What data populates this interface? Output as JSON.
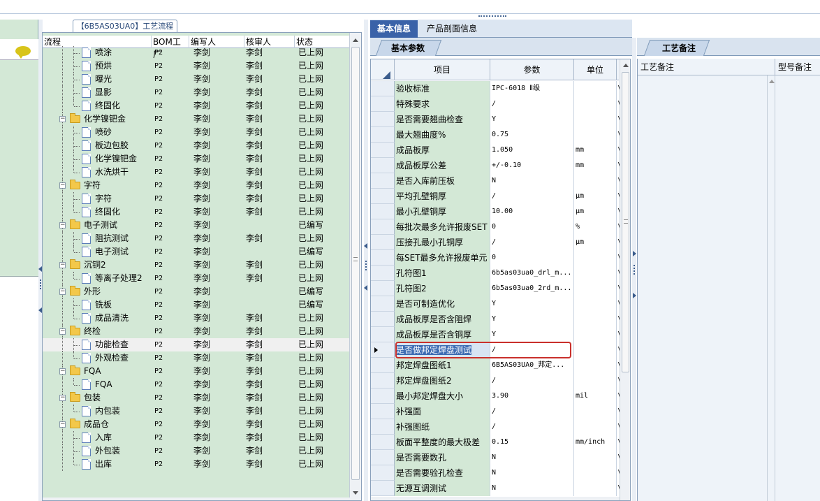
{
  "tree": {
    "title": "【6B5AS03UA0】工艺流程",
    "columns": {
      "flow": "流程",
      "bom": "BOM工厂",
      "writer": "编写人",
      "reviewer": "核审人",
      "status": "状态"
    },
    "rows": [
      {
        "type": "leaf",
        "label": "喷涂",
        "bom": "P2",
        "writer": "李剑",
        "reviewer": "李剑",
        "status": "已上网"
      },
      {
        "type": "leaf",
        "label": "预烘",
        "bom": "P2",
        "writer": "李剑",
        "reviewer": "李剑",
        "status": "已上网"
      },
      {
        "type": "leaf",
        "label": "曝光",
        "bom": "P2",
        "writer": "李剑",
        "reviewer": "李剑",
        "status": "已上网"
      },
      {
        "type": "leaf",
        "label": "显影",
        "bom": "P2",
        "writer": "李剑",
        "reviewer": "李剑",
        "status": "已上网"
      },
      {
        "type": "leaf",
        "label": "终固化",
        "bom": "P2",
        "writer": "李剑",
        "reviewer": "李剑",
        "status": "已上网"
      },
      {
        "type": "folder",
        "label": "化学镍钯金",
        "bom": "P2",
        "writer": "李剑",
        "reviewer": "李剑",
        "status": "已上网"
      },
      {
        "type": "leaf",
        "label": "喷砂",
        "bom": "P2",
        "writer": "李剑",
        "reviewer": "李剑",
        "status": "已上网"
      },
      {
        "type": "leaf",
        "label": "板边包胶",
        "bom": "P2",
        "writer": "李剑",
        "reviewer": "李剑",
        "status": "已上网"
      },
      {
        "type": "leaf",
        "label": "化学镍钯金",
        "bom": "P2",
        "writer": "李剑",
        "reviewer": "李剑",
        "status": "已上网"
      },
      {
        "type": "leaf",
        "label": "水洗烘干",
        "bom": "P2",
        "writer": "李剑",
        "reviewer": "李剑",
        "status": "已上网"
      },
      {
        "type": "folder",
        "label": "字符",
        "bom": "P2",
        "writer": "李剑",
        "reviewer": "李剑",
        "status": "已上网"
      },
      {
        "type": "leaf",
        "label": "字符",
        "bom": "P2",
        "writer": "李剑",
        "reviewer": "李剑",
        "status": "已上网"
      },
      {
        "type": "leaf",
        "label": "终固化",
        "bom": "P2",
        "writer": "李剑",
        "reviewer": "李剑",
        "status": "已上网"
      },
      {
        "type": "folder",
        "label": "电子测试",
        "bom": "P2",
        "writer": "李剑",
        "reviewer": "",
        "status": "已编写"
      },
      {
        "type": "leaf",
        "label": "阻抗测试",
        "bom": "P2",
        "writer": "李剑",
        "reviewer": "李剑",
        "status": "已上网"
      },
      {
        "type": "leaf",
        "label": "电子测试",
        "bom": "P2",
        "writer": "李剑",
        "reviewer": "",
        "status": "已编写"
      },
      {
        "type": "folder",
        "label": "沉铜2",
        "bom": "P2",
        "writer": "李剑",
        "reviewer": "李剑",
        "status": "已上网"
      },
      {
        "type": "leaf",
        "label": "等离子处理2",
        "bom": "P2",
        "writer": "李剑",
        "reviewer": "李剑",
        "status": "已上网"
      },
      {
        "type": "folder",
        "label": "外形",
        "bom": "P2",
        "writer": "李剑",
        "reviewer": "",
        "status": "已编写"
      },
      {
        "type": "leaf",
        "label": "铣板",
        "bom": "P2",
        "writer": "李剑",
        "reviewer": "",
        "status": "已编写"
      },
      {
        "type": "leaf",
        "label": "成品清洗",
        "bom": "P2",
        "writer": "李剑",
        "reviewer": "李剑",
        "status": "已上网"
      },
      {
        "type": "folder",
        "label": "终检",
        "bom": "P2",
        "writer": "李剑",
        "reviewer": "李剑",
        "status": "已上网"
      },
      {
        "type": "leaf",
        "label": "功能检查",
        "bom": "P2",
        "writer": "李剑",
        "reviewer": "李剑",
        "status": "已上网",
        "selected": true
      },
      {
        "type": "leaf",
        "label": "外观检查",
        "bom": "P2",
        "writer": "李剑",
        "reviewer": "李剑",
        "status": "已上网"
      },
      {
        "type": "folder",
        "label": "FQA",
        "bom": "P2",
        "writer": "李剑",
        "reviewer": "李剑",
        "status": "已上网"
      },
      {
        "type": "leaf",
        "label": "FQA",
        "bom": "P2",
        "writer": "李剑",
        "reviewer": "李剑",
        "status": "已上网"
      },
      {
        "type": "folder",
        "label": "包装",
        "bom": "P2",
        "writer": "李剑",
        "reviewer": "李剑",
        "status": "已上网"
      },
      {
        "type": "leaf",
        "label": "内包装",
        "bom": "P2",
        "writer": "李剑",
        "reviewer": "李剑",
        "status": "已上网"
      },
      {
        "type": "folder",
        "label": "成品仓",
        "bom": "P2",
        "writer": "李剑",
        "reviewer": "李剑",
        "status": "已上网"
      },
      {
        "type": "leaf",
        "label": "入库",
        "bom": "P2",
        "writer": "李剑",
        "reviewer": "李剑",
        "status": "已上网"
      },
      {
        "type": "leaf",
        "label": "外包装",
        "bom": "P2",
        "writer": "李剑",
        "reviewer": "李剑",
        "status": "已上网"
      },
      {
        "type": "leaf",
        "label": "出库",
        "bom": "P2",
        "writer": "李剑",
        "reviewer": "李剑",
        "status": "已上网"
      }
    ]
  },
  "main_tabs": {
    "basic_info": "基本信息",
    "profile_info": "产品剖面信息"
  },
  "params": {
    "subtab": "基本参数",
    "columns": {
      "item": "项目",
      "param": "参数",
      "unit": "单位"
    },
    "rows": [
      {
        "item": "验收标准",
        "param": "IPC-6018 Ⅱ级",
        "unit": "",
        "extra": "\\"
      },
      {
        "item": "特殊要求",
        "param": "/",
        "unit": "",
        "extra": "\\"
      },
      {
        "item": "是否需要翘曲检查",
        "param": "Y",
        "unit": "",
        "extra": "\\"
      },
      {
        "item": "最大翘曲度%",
        "param": "0.75",
        "unit": "",
        "extra": "\\"
      },
      {
        "item": "成品板厚",
        "param": "1.050",
        "unit": "mm",
        "extra": "\\"
      },
      {
        "item": "成品板厚公差",
        "param": "+/-0.10",
        "unit": "mm",
        "extra": "\\"
      },
      {
        "item": "是否入库前压板",
        "param": "N",
        "unit": "",
        "extra": "\\"
      },
      {
        "item": "平均孔壁铜厚",
        "param": "/",
        "unit": "μm",
        "extra": "\\"
      },
      {
        "item": "最小孔壁铜厚",
        "param": "10.00",
        "unit": "μm",
        "extra": "\\"
      },
      {
        "item": "每批次最多允许报废SET",
        "param": "0",
        "unit": "%",
        "extra": "\\"
      },
      {
        "item": "压接孔最小孔铜厚",
        "param": "/",
        "unit": "μm",
        "extra": "\\"
      },
      {
        "item": "每SET最多允许报废单元",
        "param": "0",
        "unit": "",
        "extra": "\\"
      },
      {
        "item": "孔符图1",
        "param": "6b5as03ua0_drl_m...",
        "unit": "",
        "extra": "\\"
      },
      {
        "item": "孔符图2",
        "param": "6b5as03ua0_2rd_m...",
        "unit": "",
        "extra": "\\"
      },
      {
        "item": "是否可制造优化",
        "param": "Y",
        "unit": "",
        "extra": "\\"
      },
      {
        "item": "成品板厚是否含阻焊",
        "param": "Y",
        "unit": "",
        "extra": "\\"
      },
      {
        "item": "成品板厚是否含铜厚",
        "param": "Y",
        "unit": "",
        "extra": "\\"
      },
      {
        "item": "是否做邦定焊盘测试",
        "param": "/",
        "unit": "",
        "extra": "\\",
        "current": true
      },
      {
        "item": "邦定焊盘图纸1",
        "param": "6B5AS03UA0_邦定...",
        "unit": "",
        "extra": "\\"
      },
      {
        "item": "邦定焊盘图纸2",
        "param": "/",
        "unit": "",
        "extra": "\\"
      },
      {
        "item": "最小邦定焊盘大小",
        "param": "3.90",
        "unit": "mil",
        "extra": "\\"
      },
      {
        "item": "补强面",
        "param": "/",
        "unit": "",
        "extra": "\\"
      },
      {
        "item": "补强图纸",
        "param": "/",
        "unit": "",
        "extra": "\\"
      },
      {
        "item": "板面平整度的最大极差",
        "param": "0.15",
        "unit": "mm/inch",
        "extra": "\\"
      },
      {
        "item": "是否需要数孔",
        "param": "N",
        "unit": "",
        "extra": "\\"
      },
      {
        "item": "是否需要验孔检查",
        "param": "N",
        "unit": "",
        "extra": "\\"
      },
      {
        "item": "无源互调测试",
        "param": "N",
        "unit": "",
        "extra": "\\"
      }
    ]
  },
  "remarks": {
    "tab": "工艺备注",
    "columns": {
      "remark": "工艺备注",
      "model_remark": "型号备注"
    }
  }
}
